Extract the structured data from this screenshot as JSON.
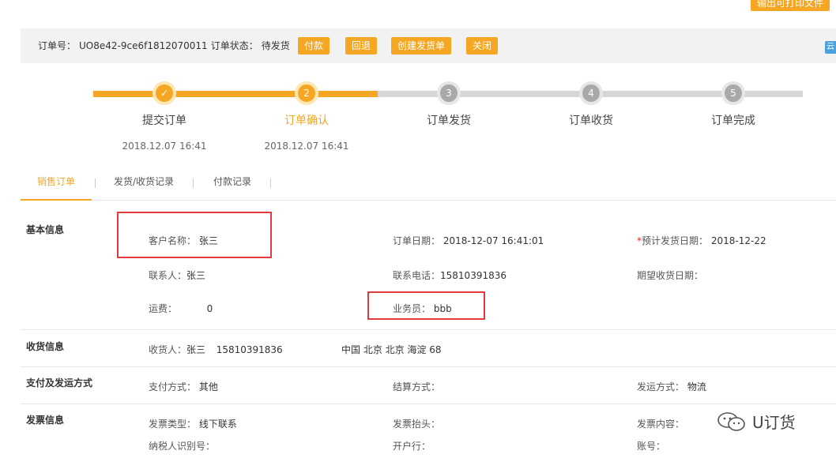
{
  "top_button": "输出可打印文件",
  "order_bar": {
    "order_no_label": "订单号：",
    "order_no": "UO8e42-9ce6f1812070011",
    "status_label": "订单状态：",
    "status": "待发货",
    "buttons": [
      "付款",
      "回退",
      "创建发货单",
      "关闭"
    ]
  },
  "edge_icon_text": "云",
  "steps": [
    {
      "num": "✓",
      "name": "提交订单",
      "time": "2018.12.07 16:41",
      "state": "done"
    },
    {
      "num": "2",
      "name": "订单确认",
      "time": "2018.12.07 16:41",
      "state": "active"
    },
    {
      "num": "3",
      "name": "订单发货",
      "time": "",
      "state": "todo"
    },
    {
      "num": "4",
      "name": "订单收货",
      "time": "",
      "state": "todo"
    },
    {
      "num": "5",
      "name": "订单完成",
      "time": "",
      "state": "todo"
    }
  ],
  "tabs": [
    "销售订单",
    "发货/收货记录",
    "付款记录"
  ],
  "basic": {
    "title": "基本信息",
    "customer_label": "客户名称：",
    "customer": "张三",
    "order_date_label": "订单日期：",
    "order_date": "2018-12-07 16:41:01",
    "ship_date_req": "*",
    "ship_date_label": "预计发货日期：",
    "ship_date": "2018-12-22",
    "contact_label": "联系人：",
    "contact": "张三",
    "phone_label": "联系电话：",
    "phone": "15810391836",
    "expect_label": "期望收货日期：",
    "freight_label": "运费：",
    "freight": "0",
    "sales_label": "业务员：",
    "sales": "bbb"
  },
  "receive": {
    "title": "收货信息",
    "receiver_label": "收货人：",
    "receiver": "张三",
    "receiver_phone": "15810391836",
    "address": "中国 北京 北京 海淀 68"
  },
  "payment": {
    "title": "支付及发运方式",
    "pay_label": "支付方式：",
    "pay": "其他",
    "settle_label": "结算方式：",
    "ship_label": "发运方式：",
    "ship": "物流"
  },
  "invoice": {
    "title": "发票信息",
    "type_label": "发票类型：",
    "type": "线下联系",
    "header_label": "发票抬头：",
    "content_label": "发票内容：",
    "tax_label": "纳税人识别号：",
    "bank_label": "开户行：",
    "account_label": "账号："
  },
  "watermark": "U订货",
  "colors": {
    "accent": "#f5a623",
    "highlight": "#e23b3b",
    "track": "#d6d6d6"
  }
}
